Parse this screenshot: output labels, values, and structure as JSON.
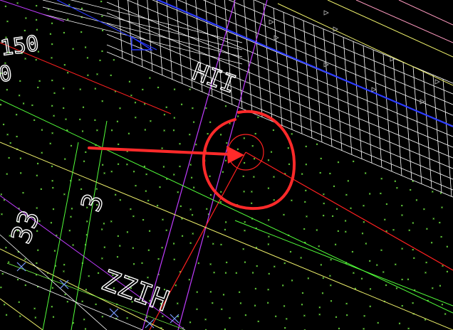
{
  "app": {
    "view": "cad-drawing-canvas"
  },
  "colors": {
    "background": "#000000",
    "hatch": "#7CFF4A",
    "grid_white": "#FFFFFF",
    "magenta": "#C03CFF",
    "blue": "#2B3BFF",
    "red": "#FF2020",
    "yellow": "#F1F36C",
    "green": "#52FF3A",
    "pink": "#FF9AC0",
    "markup_red": "#FF2A2A"
  },
  "annotations": {
    "left_label_1": "150",
    "left_label_2": "0",
    "dim_label_1": "33",
    "dim_label_2": "3",
    "dim_label_3": "ZZIH",
    "dim_label_4": "HII"
  },
  "markup": {
    "type": "callout-circle-with-arrow",
    "description": ""
  }
}
